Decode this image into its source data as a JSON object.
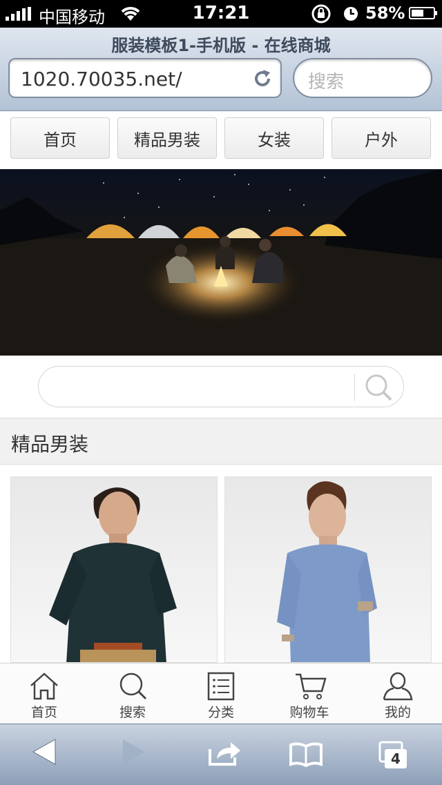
{
  "status_bar": {
    "carrier": "中国移动",
    "time": "17:21",
    "battery_percent": "58%",
    "battery_level": 0.58
  },
  "browser": {
    "page_title": "服装模板1-手机版 - 在线商城",
    "url": "1020.70035.net/",
    "search_placeholder": "搜索",
    "open_tabs": "4"
  },
  "nav": {
    "items": [
      {
        "label": "首页"
      },
      {
        "label": "精品男装"
      },
      {
        "label": "女装"
      },
      {
        "label": "户外"
      }
    ]
  },
  "section": {
    "title": "精品男装"
  },
  "tabbar": {
    "items": [
      {
        "label": "首页",
        "icon": "home-icon"
      },
      {
        "label": "搜索",
        "icon": "search-icon"
      },
      {
        "label": "分类",
        "icon": "list-icon"
      },
      {
        "label": "购物车",
        "icon": "cart-icon"
      },
      {
        "label": "我的",
        "icon": "user-icon"
      }
    ]
  },
  "colors": {
    "toolbar_top": "#dfe6ef",
    "toolbar_bottom": "#8d9fb8"
  }
}
